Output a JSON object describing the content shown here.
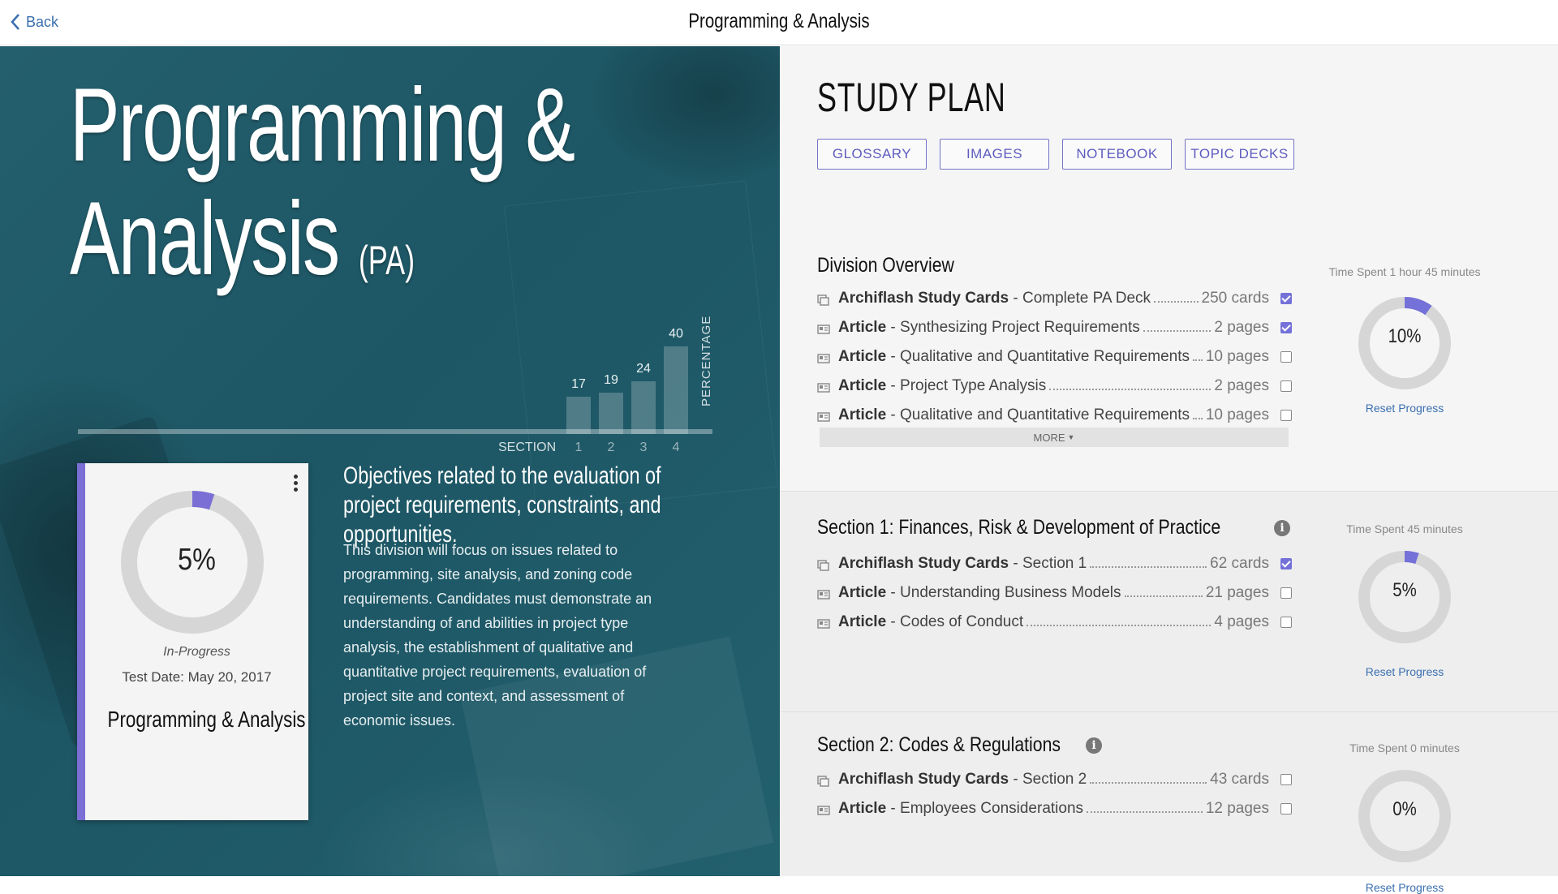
{
  "topbar": {
    "back_label": "Back",
    "title": "Programming & Analysis"
  },
  "hero": {
    "title_line1": "Programming &",
    "title_line2": "Analysis",
    "abbr": "(PA)",
    "chart_data": {
      "type": "bar",
      "categories": [
        "1",
        "2",
        "3",
        "4"
      ],
      "values": [
        17,
        19,
        24,
        40
      ],
      "xlabel": "SECTION",
      "ylabel": "PERCENTAGE",
      "ylim": [
        0,
        40
      ]
    },
    "card": {
      "percent_label": "5%",
      "percent": 5,
      "status": "In-Progress",
      "test_date": "Test Date: May 20, 2017",
      "title": "Programming & Analysis",
      "accent": "#7b6fd6"
    },
    "objective": "Objectives related to the evaluation of project requirements, constraints, and opportunities.",
    "description": "This division will focus on issues related to programming, site analysis, and zoning code requirements. Candidates must demonstrate an understanding of and abilities in project type analysis, the establishment of qualitative and quantitative project requirements, evaluation of project site and context, and assessment of economic issues."
  },
  "study_plan": {
    "title": "STUDY PLAN",
    "tabs": [
      "GLOSSARY",
      "IMAGES",
      "NOTEBOOK",
      "TOPIC DECKS"
    ],
    "sections": [
      {
        "heading": "Division Overview",
        "has_info": false,
        "time_spent": "Time Spent 1 hour 45 minutes",
        "percent_label": "10%",
        "percent": 10,
        "reset_label": "Reset Progress",
        "more_label": "MORE",
        "items": [
          {
            "type": "Archiflash Study Cards",
            "name": " - Complete PA Deck",
            "count": "250 cards",
            "checked": true,
            "icon": "cards-icon"
          },
          {
            "type": "Article",
            "name": " - Synthesizing Project Requirements",
            "count": "2 pages",
            "checked": true,
            "icon": "article-icon"
          },
          {
            "type": "Article",
            "name": " - Qualitative and Quantitative Requirements",
            "count": "10 pages",
            "checked": false,
            "icon": "article-icon"
          },
          {
            "type": "Article",
            "name": " - Project Type Analysis",
            "count": "2 pages",
            "checked": false,
            "icon": "article-icon"
          },
          {
            "type": "Article",
            "name": " - Qualitative and Quantitative Requirements",
            "count": "10 pages",
            "checked": false,
            "icon": "article-icon"
          }
        ]
      },
      {
        "heading": "Section 1: Finances, Risk & Development of Practice",
        "has_info": true,
        "time_spent": "Time Spent 45 minutes",
        "percent_label": "5%",
        "percent": 5,
        "reset_label": "Reset Progress",
        "items": [
          {
            "type": "Archiflash Study Cards",
            "name": " - Section 1",
            "count": "62 cards",
            "checked": true,
            "icon": "cards-icon"
          },
          {
            "type": "Article",
            "name": " - Understanding Business Models",
            "count": "21 pages",
            "checked": false,
            "icon": "article-icon"
          },
          {
            "type": "Article",
            "name": " - Codes of Conduct",
            "count": "4 pages",
            "checked": false,
            "icon": "article-icon"
          }
        ]
      },
      {
        "heading": "Section 2: Codes & Regulations",
        "has_info": true,
        "time_spent": "Time Spent 0 minutes",
        "percent_label": "0%",
        "percent": 0,
        "reset_label": "Reset Progress",
        "items": [
          {
            "type": "Archiflash Study Cards",
            "name": " - Section 2",
            "count": "43 cards",
            "checked": false,
            "icon": "cards-icon"
          },
          {
            "type": "Article",
            "name": " - Employees Considerations",
            "count": "12 pages",
            "checked": false,
            "icon": "article-icon"
          }
        ]
      }
    ]
  },
  "colors": {
    "accent": "#7471d9",
    "hero_bg": "#1f5a68",
    "link": "#3a6fb0",
    "tab_border": "#7472c7"
  }
}
